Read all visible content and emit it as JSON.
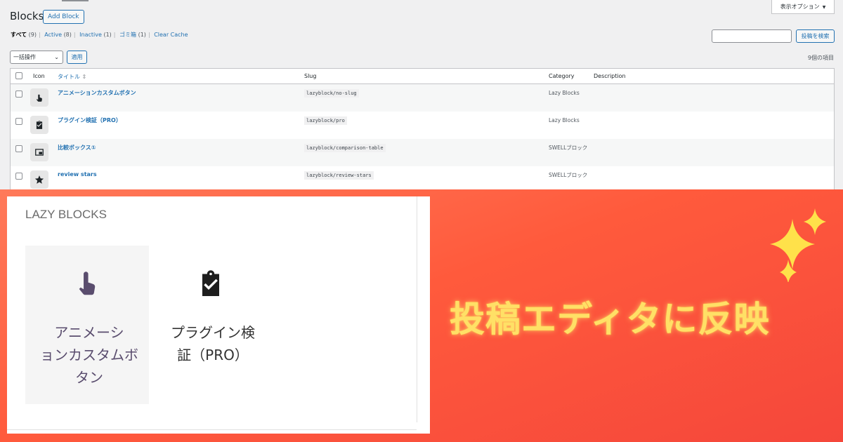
{
  "admin": {
    "page_title": "Blocks",
    "add_button": "Add Block",
    "screen_options": "表示オプション",
    "filters": [
      {
        "label": "すべて",
        "count": "(9)"
      },
      {
        "label": "Active",
        "count": "(8)"
      },
      {
        "label": "Inactive",
        "count": "(1)"
      },
      {
        "label": "ゴミ箱",
        "count": "(1)"
      },
      {
        "label": "Clear Cache",
        "count": ""
      }
    ],
    "search_button": "投稿を検索",
    "bulk_action": "一括操作",
    "apply_button": "適用",
    "item_count": "9個の項目",
    "columns": {
      "icon": "Icon",
      "title": "タイトル",
      "slug": "Slug",
      "category": "Category",
      "description": "Description"
    },
    "rows": [
      {
        "title": "アニメーションカスタムボタン",
        "slug": "lazyblock/no-slug",
        "category": "Lazy Blocks",
        "icon": "touch-hand-icon"
      },
      {
        "title": "プラグイン検証（PRO）",
        "slug": "lazyblock/pro",
        "category": "Lazy Blocks",
        "icon": "clipboard-check-icon"
      },
      {
        "title": "比較ボックス①",
        "slug": "lazyblock/comparison-table",
        "category": "SWELLブロック",
        "icon": "picture-in-picture-icon"
      },
      {
        "title": "review stars",
        "slug": "lazyblock/review-stars",
        "category": "SWELLブロック",
        "icon": "star-icon"
      }
    ]
  },
  "editor": {
    "panel_title": "LAZY BLOCKS",
    "blocks": [
      {
        "label_line1": "アニメーシ",
        "label_line2": "ョンカスタムボ",
        "label_line3": "タン",
        "icon": "touch-hand-icon"
      },
      {
        "label_line1": "プラグイン検",
        "label_line2": "証（PRO）",
        "icon": "clipboard-check-icon"
      }
    ]
  },
  "headline": "投稿エディタに反映",
  "colors": {
    "banner_start": "#ff7a5a",
    "banner_end": "#f5473b",
    "headline": "#ffe066",
    "link": "#2271b1",
    "block_icon_purple": "#5a4d6e"
  }
}
